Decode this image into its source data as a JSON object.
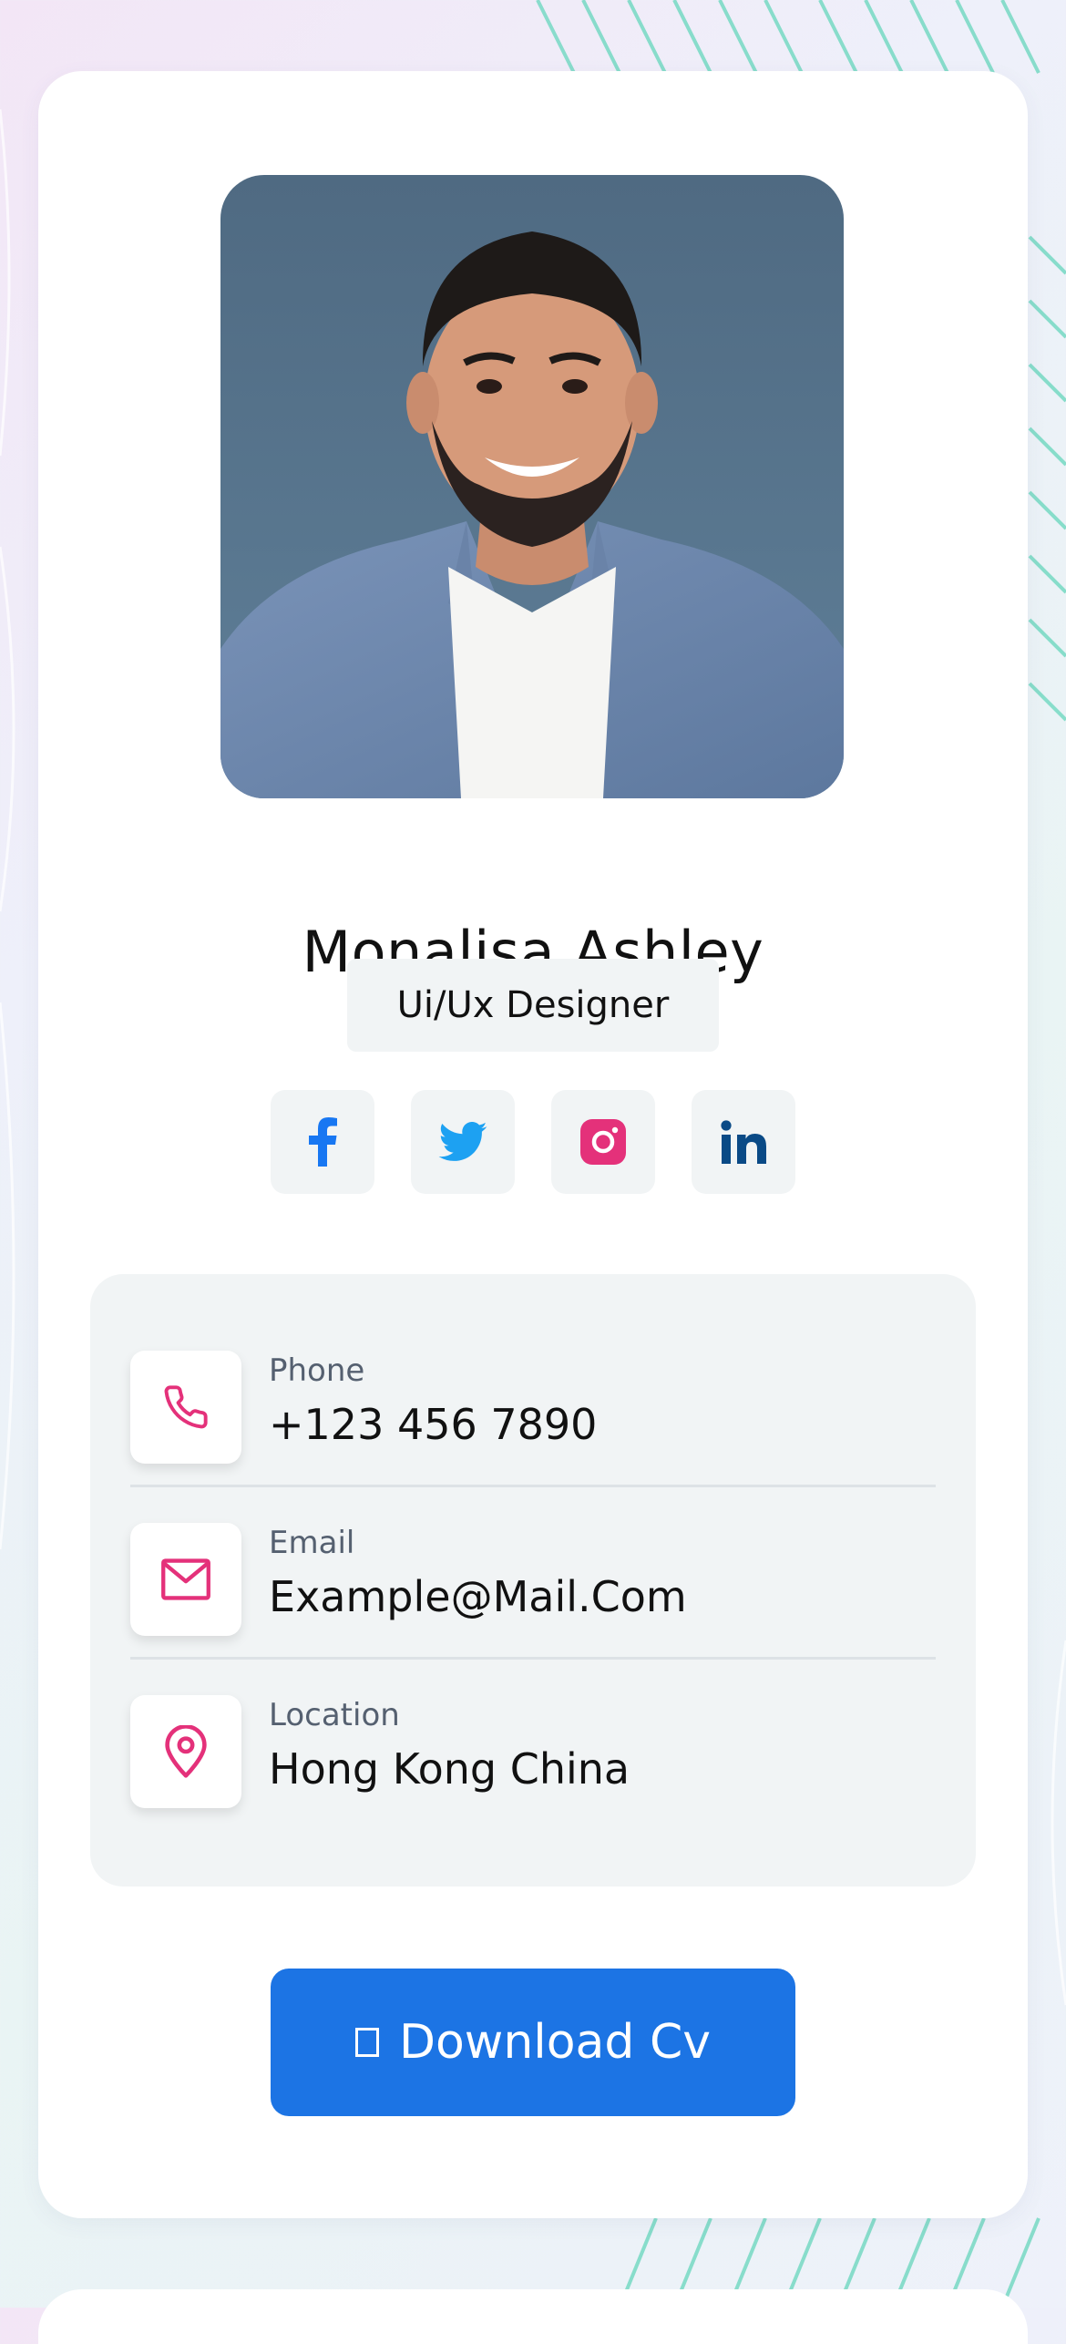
{
  "profile": {
    "name": "Monalisa Ashley",
    "role": "Ui/Ux Designer"
  },
  "socials": [
    {
      "icon": "facebook-icon",
      "color": "#1877f2"
    },
    {
      "icon": "twitter-icon",
      "color": "#1da1f2"
    },
    {
      "icon": "instagram-icon",
      "color": "#e4317a"
    },
    {
      "icon": "linkedin-icon",
      "color": "#0a4a86"
    }
  ],
  "contact": {
    "phone": {
      "label": "Phone",
      "value": "+123 456 7890",
      "icon": "phone-icon"
    },
    "email": {
      "label": "Email",
      "value": "Example@Mail.Com",
      "icon": "mail-icon"
    },
    "location": {
      "label": "Location",
      "value": "Hong Kong China",
      "icon": "location-pin-icon"
    }
  },
  "download": {
    "label": "Download Cv",
    "icon": "download-icon"
  },
  "colors": {
    "accent": "#1c74e4",
    "icon_pink": "#e4317a",
    "panel": "#f1f4f5"
  }
}
